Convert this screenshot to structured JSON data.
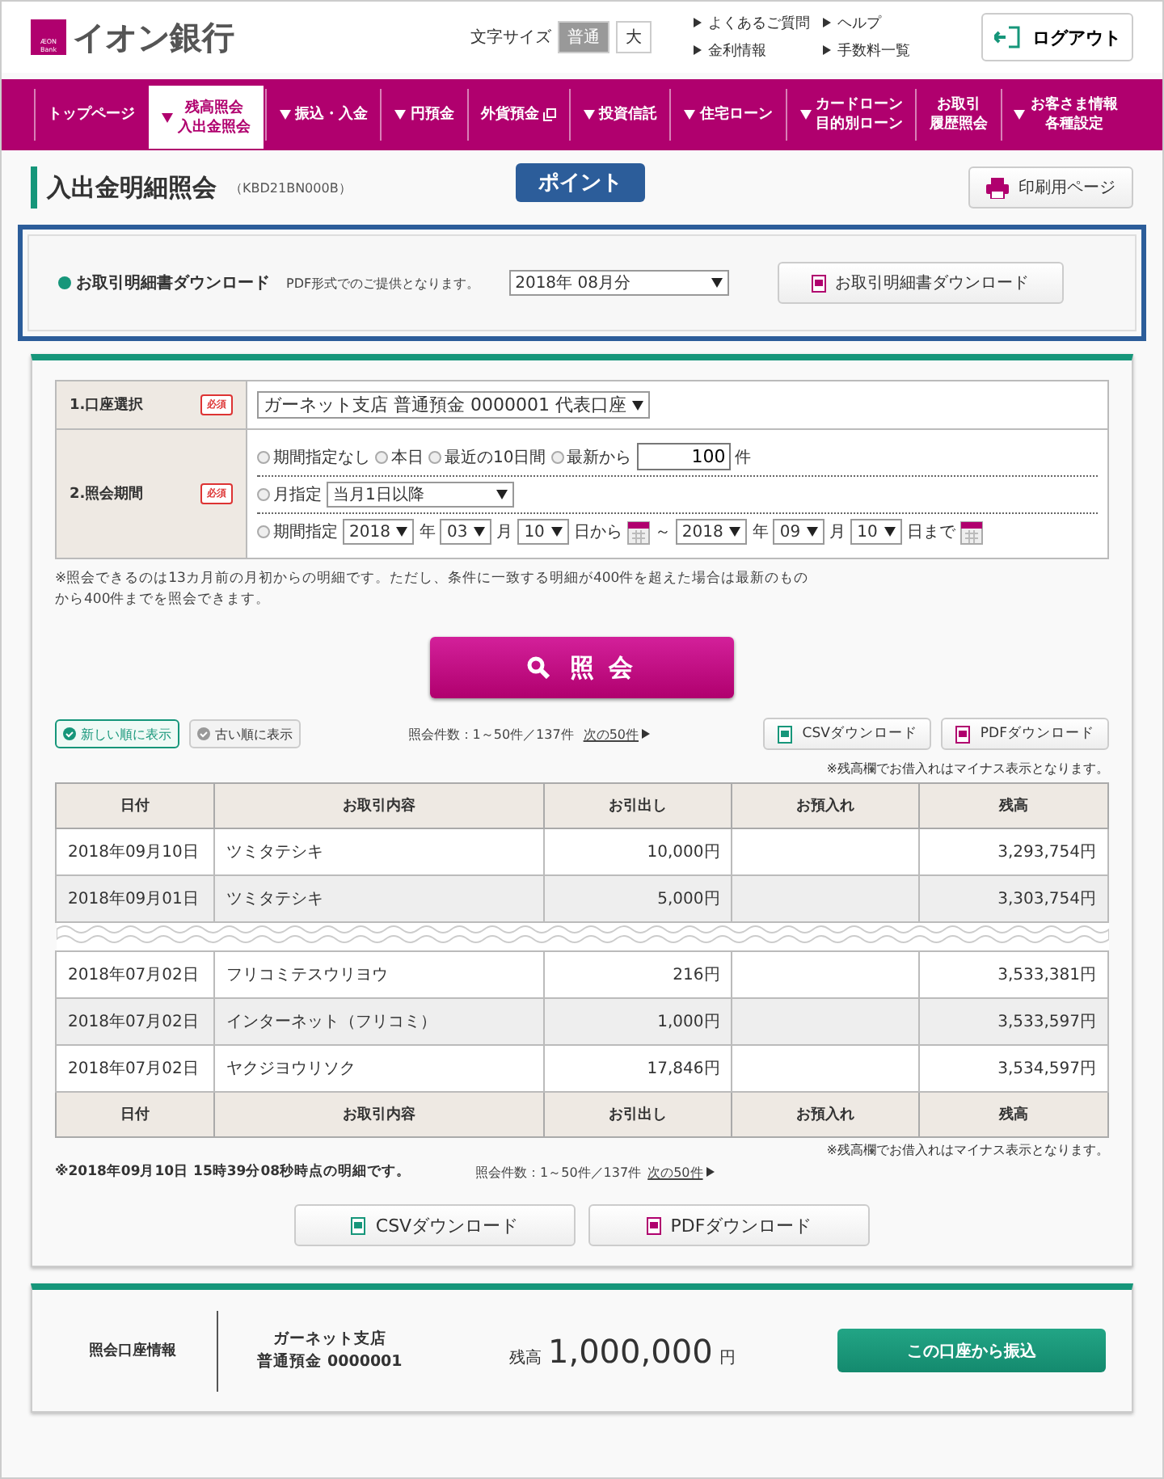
{
  "header": {
    "logo": {
      "mark": "ÆON",
      "sub": "Bank",
      "name": "イオン銀行"
    },
    "font_size": {
      "label": "文字サイズ",
      "options": [
        {
          "label": "普通",
          "selected": true
        },
        {
          "label": "大",
          "selected": false
        }
      ]
    },
    "links": [
      "よくあるご質問",
      "ヘルプ",
      "金利情報",
      "手数料一覧"
    ],
    "logout": "ログアウト"
  },
  "nav": [
    {
      "lines": [
        "トップページ"
      ],
      "caret": false,
      "external": false,
      "selected": false
    },
    {
      "lines": [
        "残高照会",
        "入出金照会"
      ],
      "caret": true,
      "external": false,
      "selected": true
    },
    {
      "lines": [
        "振込・入金"
      ],
      "caret": true,
      "external": false,
      "selected": false
    },
    {
      "lines": [
        "円預金"
      ],
      "caret": true,
      "external": false,
      "selected": false
    },
    {
      "lines": [
        "外貨預金"
      ],
      "caret": false,
      "external": true,
      "selected": false
    },
    {
      "lines": [
        "投資信託"
      ],
      "caret": true,
      "external": false,
      "selected": false
    },
    {
      "lines": [
        "住宅ローン"
      ],
      "caret": true,
      "external": false,
      "selected": false
    },
    {
      "lines": [
        "カードローン",
        "目的別ローン"
      ],
      "caret": true,
      "external": false,
      "selected": false
    },
    {
      "lines": [
        "お取引",
        "履歴照会"
      ],
      "caret": false,
      "external": false,
      "selected": false
    },
    {
      "lines": [
        "お客さま情報",
        "各種設定"
      ],
      "caret": true,
      "external": false,
      "selected": false
    }
  ],
  "page": {
    "title": "入出金明細照会",
    "code": "（KBD21BN000B）",
    "callout": "ポイント",
    "print_button": "印刷用ページ"
  },
  "statement_download": {
    "label": "お取引明細書ダウンロード",
    "note": "PDF形式でのご提供となります。",
    "month": "2018年 08月分",
    "button": "お取引明細書ダウンロード"
  },
  "form": {
    "account": {
      "label": "1.口座選択",
      "required": "必須",
      "value": "ガーネット支店 普通預金 0000001 代表口座"
    },
    "period": {
      "label": "2.照会期間",
      "required": "必須",
      "lines": [
        [
          {
            "kind": "radio",
            "label": "期間指定なし",
            "selected": false
          },
          {
            "kind": "radio",
            "label": "本日",
            "selected": false
          },
          {
            "kind": "radio",
            "label": "最近の10日間",
            "selected": false
          },
          {
            "kind": "radio",
            "label": "最新から",
            "selected": false
          },
          {
            "kind": "field",
            "value": "100"
          },
          {
            "kind": "text",
            "label": "件"
          }
        ],
        [
          {
            "kind": "radio",
            "label": "月指定",
            "selected": false
          },
          {
            "kind": "select",
            "value": "当月1日以降",
            "wide": true
          }
        ],
        [
          {
            "kind": "radio",
            "label": "期間指定",
            "selected": false
          },
          {
            "kind": "select",
            "value": "2018"
          },
          {
            "kind": "text",
            "label": "年"
          },
          {
            "kind": "select",
            "value": "03"
          },
          {
            "kind": "text",
            "label": "月"
          },
          {
            "kind": "select",
            "value": "10"
          },
          {
            "kind": "text",
            "label": "日から"
          },
          {
            "kind": "calendar"
          },
          {
            "kind": "text",
            "label": "～"
          },
          {
            "kind": "select",
            "value": "2018"
          },
          {
            "kind": "text",
            "label": "年"
          },
          {
            "kind": "select",
            "value": "09"
          },
          {
            "kind": "text",
            "label": "月"
          },
          {
            "kind": "select",
            "value": "10"
          },
          {
            "kind": "text",
            "label": "日まで"
          },
          {
            "kind": "calendar"
          }
        ]
      ]
    },
    "note": "※照会できるのは13カ月前の月初からの明細です。ただし、条件に一致する明細が400件を超えた場合は最新のものから400件までを照会できます。",
    "search_button": "照 会"
  },
  "results": {
    "sort": [
      {
        "label": "新しい順に表示",
        "selected": true
      },
      {
        "label": "古い順に表示",
        "selected": false
      }
    ],
    "count": "照会件数：1～50件／137件",
    "next": "次の50件",
    "csv": "CSVダウンロード",
    "pdf": "PDFダウンロード",
    "minus_note": "※残高欄でお借入れはマイナス表示となります。",
    "table": {
      "columns": [
        "日付",
        "お取引内容",
        "お引出し",
        "お預入れ",
        "残高"
      ],
      "rows": [
        {
          "kind": "row",
          "cells": [
            "2018年09月10日",
            "ツミタテシキ",
            "10,000円",
            "",
            "3,293,754円"
          ]
        },
        {
          "kind": "row",
          "cells": [
            "2018年09月01日",
            "ツミタテシキ",
            "5,000円",
            "",
            "3,303,754円"
          ]
        },
        {
          "kind": "break"
        },
        {
          "kind": "row",
          "cells": [
            "2018年07月02日",
            "フリコミテスウリヨウ",
            "216円",
            "",
            "3,533,381円"
          ]
        },
        {
          "kind": "row",
          "cells": [
            "2018年07月02日",
            "インターネット（フリコミ）",
            "1,000円",
            "",
            "3,533,597円"
          ]
        },
        {
          "kind": "row",
          "cells": [
            "2018年07月02日",
            "ヤクジヨウリソク",
            "17,846円",
            "",
            "3,534,597円"
          ]
        }
      ]
    },
    "footer_columns": [
      "日付",
      "お取引内容",
      "お引出し",
      "お預入れ",
      "残高"
    ],
    "minus_note_bottom": "※残高欄でお借入れはマイナス表示となります。",
    "timestamp": "※2018年09月10日 15時39分08秒時点の明細です。",
    "count_bottom": "照会件数：1～50件／137件",
    "next_bottom": "次の50件",
    "csv_bottom": "CSVダウンロード",
    "pdf_bottom": "PDFダウンロード"
  },
  "account_info": {
    "label": "照会口座情報",
    "branch": "ガーネット支店",
    "account": "普通預金 0000001",
    "balance_label": "残高",
    "balance": "1,000,000",
    "unit": "円",
    "button": "この口座から振込"
  }
}
